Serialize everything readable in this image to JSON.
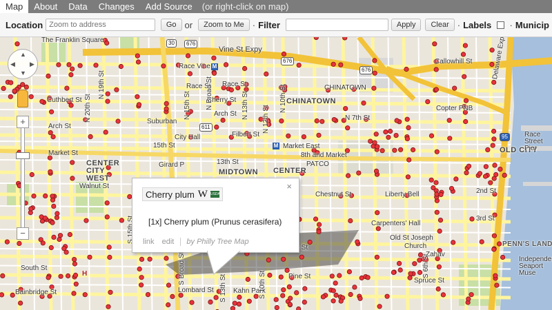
{
  "tabs": [
    {
      "label": "Map",
      "active": true
    },
    {
      "label": "About",
      "active": false
    },
    {
      "label": "Data",
      "active": false
    },
    {
      "label": "Changes",
      "active": false
    },
    {
      "label": "Add Source",
      "active": false
    }
  ],
  "tab_hint": "(or right-click on map)",
  "controls": {
    "location_label": "Location",
    "zoom_placeholder": "Zoom to address",
    "go_label": "Go",
    "or_text": "or",
    "zoom_me_label": "Zoom to Me",
    "dot": "·",
    "filter_label": "Filter",
    "apply_label": "Apply",
    "clear_label": "Clear",
    "labels_label": "Labels",
    "munic_label": "Municip"
  },
  "popup": {
    "name": "Cherry plum",
    "wiki_glyph": "W",
    "usda": "USDA",
    "description": "[1x] Cherry plum (Prunus cerasifera)",
    "link_label": "link",
    "edit_label": "edit",
    "by_label": "by Philly Tree Map",
    "close": "×"
  },
  "map_labels": {
    "vine_expy": "Vine St Expy",
    "race_vine": "Race Vine",
    "race_st": "Race St",
    "cherry_st": "Cherry St",
    "arch_st": "Arch St",
    "filbert_st": "Filbert St",
    "market_st": "Market St",
    "chestnut_st": "Chestnut St",
    "walnut_st": "Walnut St",
    "spruce_st": "Spruce St",
    "pine_st": "Pine St",
    "lombard_st": "Lombard St",
    "south_st": "South St",
    "bainbridge_st": "Bainbridge St",
    "callowhill_st": "Callowhill St",
    "cuthbert_st": "Cuthbert St",
    "chinatown": "CHINATOWN",
    "midtown": "MIDTOWN",
    "center": "CENTER",
    "center_city_west": "CENTER CITY WEST",
    "old_city": "OLD CITY",
    "city_hall": "City Hall",
    "suburban": "Suburban",
    "fifteenth_st": "15th St",
    "thirteenth_st": "13th St",
    "market_east": "Market East",
    "eighth_market": "8th and Market",
    "patco": "PATCO",
    "liberty_bell": "Liberty Bell",
    "carpenters_hall": "Carpenters' Hall",
    "old_st_joseph": "Old St Joseph",
    "church": "Church",
    "copter_pnb": "Copter PNB",
    "race_street_pier": "Race Street Pier",
    "delaware_expy": "Delaware Expy",
    "penns_landing": "PENN'S LANDING",
    "independence_seaport": "Independence Seaport Muse",
    "franklin_square": "The Franklin Square",
    "girard": "Girard P",
    "n_broad": "N Broad St",
    "n_15th": "N 15th St",
    "n_13th": "N 13th St",
    "n_12th": "N 12th St",
    "n_11th": "N 11th St",
    "n_10th": "N 10th St",
    "n_19th": "N 19th St",
    "n_20th": "N 20th St",
    "n_7th": "N 7th St",
    "s_broad": "S Broad St",
    "s_10th": "S 10th St",
    "s_6th": "S 6th St",
    "s_15th": "S 15th St",
    "s_13th": "S 13th St",
    "second_st": "2nd St",
    "third_st": "3rd St",
    "zahav": "Zahav",
    "kahn_park": "Kahn Park",
    "sixth_st_n": "6th St",
    "letter_h": "H",
    "route_611": "611",
    "route_676": "676",
    "route_30": "30",
    "route_95": "95",
    "metro": "M"
  },
  "nav": {
    "zoom_in": "+",
    "zoom_out": "−",
    "pan_up": "▲",
    "pan_down": "▼",
    "pan_left": "◀",
    "pan_right": "▶"
  },
  "colors": {
    "tree_marker": "#e8333a",
    "highway": "#f2c238",
    "street": "#fff59e",
    "water": "#a5bfdd"
  }
}
